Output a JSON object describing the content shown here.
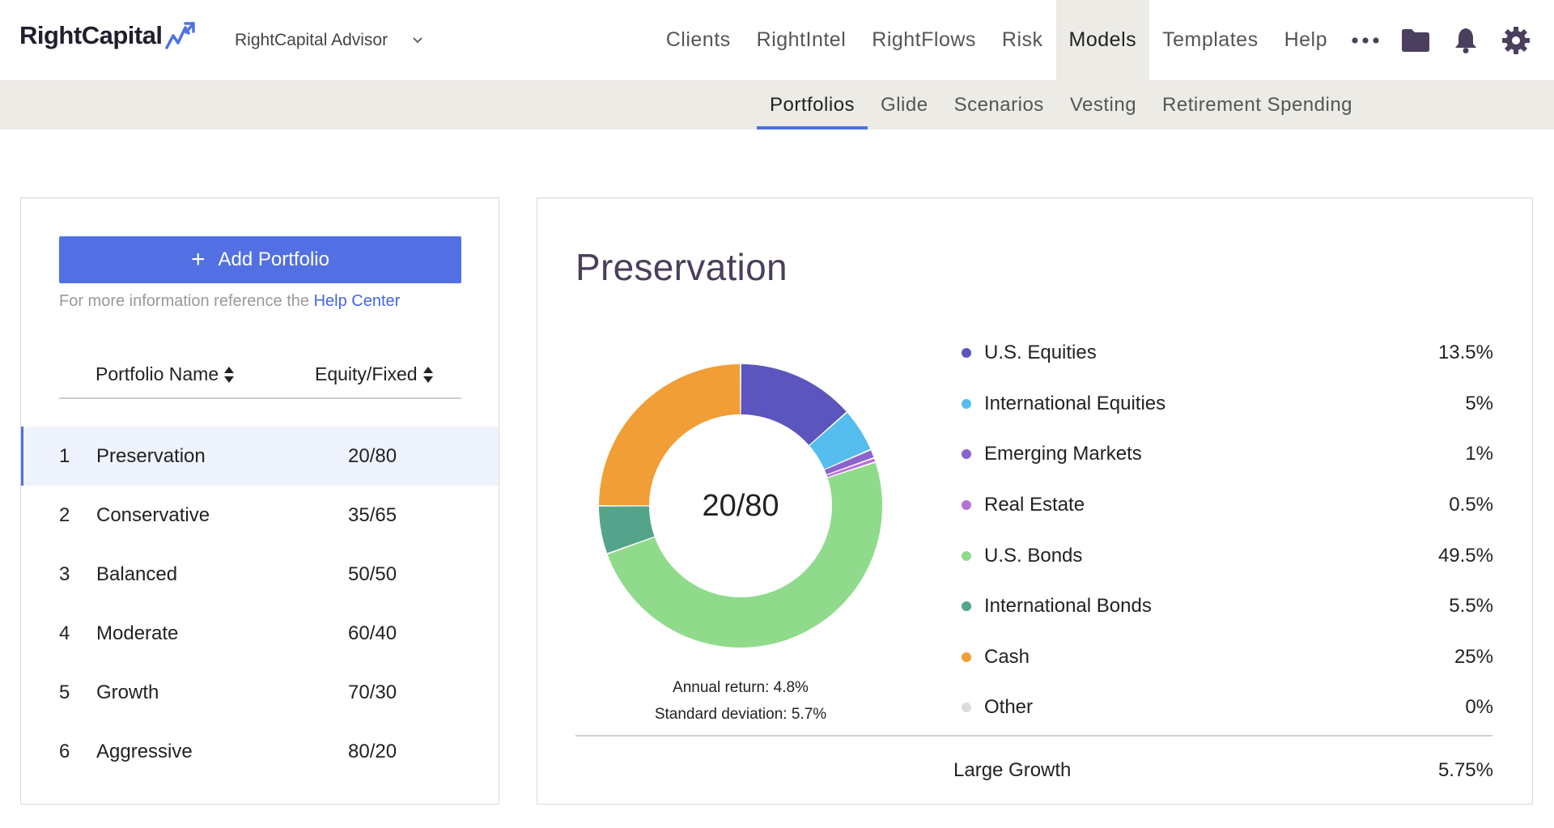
{
  "brand": {
    "logo_text": "RightCapital"
  },
  "advisor": {
    "label": "RightCapital Advisor"
  },
  "nav": {
    "items": [
      "Clients",
      "RightIntel",
      "RightFlows",
      "Risk",
      "Models",
      "Templates",
      "Help"
    ],
    "active": "Models",
    "more_label": "•••"
  },
  "subnav": {
    "items": [
      "Portfolios",
      "Glide",
      "Scenarios",
      "Vesting",
      "Retirement Spending"
    ],
    "active": "Portfolios"
  },
  "left": {
    "add_button": "Add Portfolio",
    "help_text": "For more information reference the ",
    "help_link": "Help Center",
    "columns": {
      "name": "Portfolio Name",
      "equity": "Equity/Fixed"
    },
    "portfolios": [
      {
        "idx": "1",
        "name": "Preservation",
        "ratio": "20/80",
        "selected": true
      },
      {
        "idx": "2",
        "name": "Conservative",
        "ratio": "35/65"
      },
      {
        "idx": "3",
        "name": "Balanced",
        "ratio": "50/50"
      },
      {
        "idx": "4",
        "name": "Moderate",
        "ratio": "60/40"
      },
      {
        "idx": "5",
        "name": "Growth",
        "ratio": "70/30"
      },
      {
        "idx": "6",
        "name": "Aggressive",
        "ratio": "80/20"
      }
    ]
  },
  "detail": {
    "title": "Preservation",
    "center_label": "20/80",
    "annual_return": "Annual return: 4.8%",
    "std_dev": "Standard deviation: 5.7%",
    "extra": {
      "label": "Large Growth",
      "value": "5.75%"
    }
  },
  "chart_data": {
    "type": "pie",
    "title": "",
    "center_label": "20/80",
    "categories": [
      "U.S. Equities",
      "International Equities",
      "Emerging Markets",
      "Real Estate",
      "U.S. Bonds",
      "International Bonds",
      "Cash",
      "Other"
    ],
    "values": [
      13.5,
      5,
      1,
      0.5,
      49.5,
      5.5,
      25,
      0
    ],
    "display_values": [
      "13.5%",
      "5%",
      "1%",
      "0.5%",
      "49.5%",
      "5.5%",
      "25%",
      "0%"
    ],
    "colors": [
      "#5b55bd",
      "#54bdee",
      "#8b63cf",
      "#b870d8",
      "#8fdb8b",
      "#53a48a",
      "#f09e35",
      "#dcdcdc"
    ],
    "legend_position": "right"
  }
}
